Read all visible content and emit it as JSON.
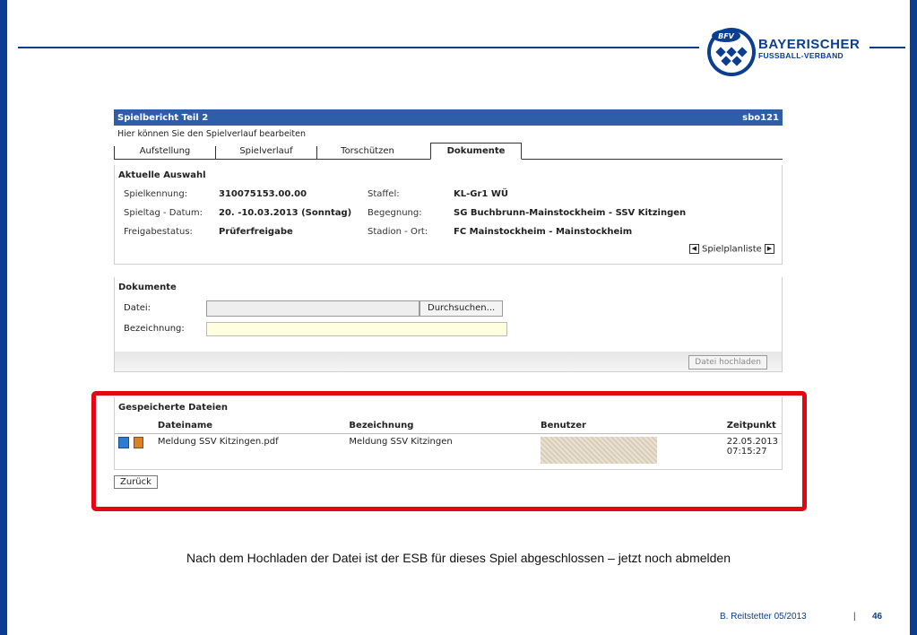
{
  "logo": {
    "line1": "BAYERISCHER",
    "line2": "FUSSBALL-VERBAND",
    "badge": "BFV"
  },
  "app": {
    "title": "Spielbericht Teil 2",
    "code": "sbo121",
    "subtitle": "Hier können Sie den Spielverlauf bearbeiten",
    "tabs": [
      "Aufstellung",
      "Spielverlauf",
      "Torschützen",
      "Dokumente"
    ],
    "active_tab": "Dokumente"
  },
  "selection": {
    "title": "Aktuelle Auswahl",
    "rows": [
      {
        "l1": "Spielkennung:",
        "v1": "310075153.00.00",
        "l2": "Staffel:",
        "v2": "KL-Gr1 WÜ"
      },
      {
        "l1": "Spieltag - Datum:",
        "v1": "20. -10.03.2013 (Sonntag)",
        "l2": "Begegnung:",
        "v2": "SG Buchbrunn-Mainstockheim - SSV Kitzingen"
      },
      {
        "l1": "Freigabestatus:",
        "v1": "Prüferfreigabe",
        "l2": "Stadion - Ort:",
        "v2": "FC Mainstockheim - Mainstockheim"
      }
    ],
    "spielplan_link": "Spielplanliste"
  },
  "documents": {
    "title": "Dokumente",
    "file_label": "Datei:",
    "browse_label": "Durchsuchen...",
    "name_label": "Bezeichnung:",
    "upload_label": "Datei hochladen"
  },
  "saved": {
    "title": "Gespeicherte Dateien",
    "headers": [
      "Dateiname",
      "Bezeichnung",
      "Benutzer",
      "Zeitpunkt"
    ],
    "row": {
      "filename": "Meldung SSV Kitzingen.pdf",
      "description": "Meldung SSV Kitzingen",
      "date": "22.05.2013",
      "time": "07:15:27"
    }
  },
  "back_label": "Zurück",
  "caption": "Nach dem Hochladen der Datei ist der ESB für dieses Spiel abgeschlossen – jetzt noch abmelden",
  "footer": {
    "author": "B. Reitstetter  05/2013",
    "sep": "|",
    "page": "46"
  },
  "colors": {
    "brand": "#0b3d91",
    "titlebar": "#2f5ea8",
    "highlight": "#e30613"
  }
}
